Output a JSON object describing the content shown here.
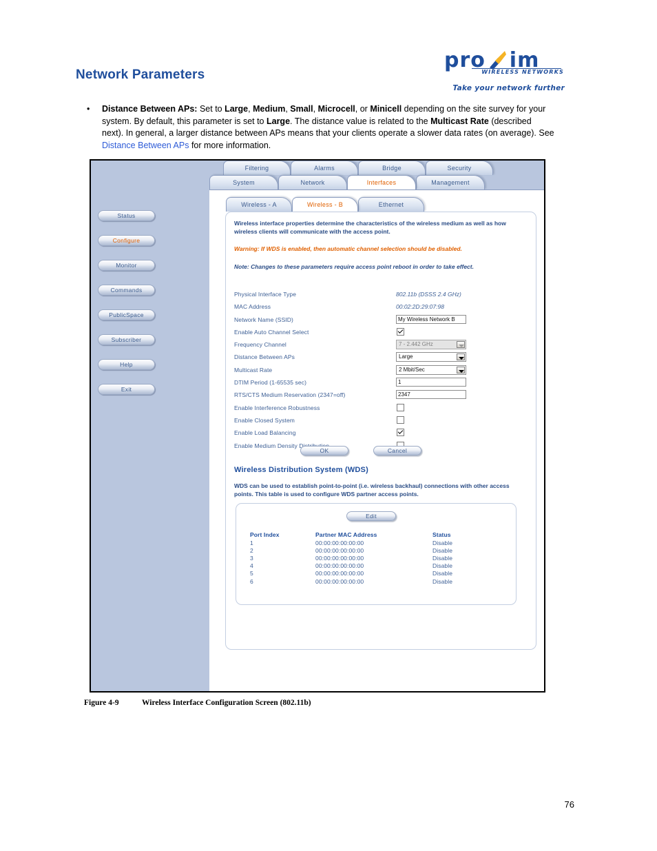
{
  "document": {
    "page_title": "Network Parameters",
    "page_number": "76",
    "figure_caption_number": "Figure 4-9",
    "figure_caption_text": "Wireless Interface Configuration Screen (802.11b)"
  },
  "logo": {
    "word_pro": "pro",
    "word_im": "im",
    "subtitle": "WIRELESS NETWORKS",
    "tagline": "Take your network further",
    "brand_blue": "#1F4E9C",
    "brand_gold": "#F5B324"
  },
  "bullet": {
    "marker": "•",
    "segments": [
      {
        "text": "Distance Between APs:",
        "style": "bold"
      },
      {
        "text": " Set to ",
        "style": "normal"
      },
      {
        "text": "Large",
        "style": "bold"
      },
      {
        "text": ", ",
        "style": "normal"
      },
      {
        "text": "Medium",
        "style": "bold"
      },
      {
        "text": ", ",
        "style": "normal"
      },
      {
        "text": "Small",
        "style": "bold"
      },
      {
        "text": ", ",
        "style": "normal"
      },
      {
        "text": "Microcell",
        "style": "bold"
      },
      {
        "text": ", or ",
        "style": "normal"
      },
      {
        "text": "Minicell",
        "style": "bold"
      },
      {
        "text": " depending on the site survey for your system. By default, this parameter is set to ",
        "style": "normal"
      },
      {
        "text": "Large",
        "style": "bold"
      },
      {
        "text": ". The distance value is related to the ",
        "style": "normal"
      },
      {
        "text": "Multicast Rate",
        "style": "bold"
      },
      {
        "text": " (described next). In general, a larger distance between APs means that your clients operate a slower data rates (on average). See ",
        "style": "normal"
      },
      {
        "text": "Distance Between APs",
        "style": "link"
      },
      {
        "text": " for more information.",
        "style": "normal"
      }
    ]
  },
  "app": {
    "sidebar": {
      "items": [
        {
          "label": "Status",
          "active": false
        },
        {
          "label": "Configure",
          "active": true
        },
        {
          "label": "Monitor",
          "active": false
        },
        {
          "label": "Commands",
          "active": false
        },
        {
          "label": "PublicSpace",
          "active": false
        },
        {
          "label": "Subscriber",
          "active": false
        },
        {
          "label": "Help",
          "active": false
        },
        {
          "label": "Exit",
          "active": false
        }
      ]
    },
    "tabs_upper": [
      {
        "label": "Filtering",
        "active": false
      },
      {
        "label": "Alarms",
        "active": false
      },
      {
        "label": "Bridge",
        "active": false
      },
      {
        "label": "Security",
        "active": false
      }
    ],
    "tabs_lower": [
      {
        "label": "System",
        "active": false
      },
      {
        "label": "Network",
        "active": false
      },
      {
        "label": "Interfaces",
        "active": true
      },
      {
        "label": "Management",
        "active": false
      }
    ],
    "tabs_sub": [
      {
        "label": "Wireless - A",
        "active": false
      },
      {
        "label": "Wireless - B",
        "active": true
      },
      {
        "label": "Ethernet",
        "active": false
      }
    ],
    "intro": "Wireless interface properties determine the characteristics of the wireless medium as well as how wireless clients will communicate with the access point.",
    "warning": "Warning: If WDS is enabled, then automatic channel selection should be disabled.",
    "note": "Note: Changes to these parameters require access point reboot in order to take effect.",
    "form_rows": [
      {
        "label": "Physical Interface Type",
        "type": "static",
        "value": "802.11b (DSSS 2.4 GHz)"
      },
      {
        "label": "MAC Address",
        "type": "static",
        "value": "00:02:2D:29:07:98"
      },
      {
        "label": "Network Name (SSID)",
        "type": "text",
        "value": "My Wireless Network B"
      },
      {
        "label": "Enable Auto Channel Select",
        "type": "checkbox",
        "checked": true
      },
      {
        "label": "Frequency Channel",
        "type": "select",
        "value": "7 - 2.442 GHz",
        "disabled": true
      },
      {
        "label": "Distance Between APs",
        "type": "select",
        "value": "Large",
        "disabled": false
      },
      {
        "label": "Multicast Rate",
        "type": "select",
        "value": "2 Mbit/Sec",
        "disabled": false
      },
      {
        "label": "DTIM Period (1-65535 sec)",
        "type": "text",
        "value": "1"
      },
      {
        "label": "RTS/CTS Medium Reservation (2347=off)",
        "type": "text",
        "value": "2347"
      },
      {
        "label": "Enable Interference Robustness",
        "type": "checkbox",
        "checked": false
      },
      {
        "label": "Enable Closed System",
        "type": "checkbox",
        "checked": false
      },
      {
        "label": "Enable Load Balancing",
        "type": "checkbox",
        "checked": true
      },
      {
        "label": "Enable Medium Density Distribution",
        "type": "checkbox",
        "checked": false
      }
    ],
    "actions": {
      "ok_label": "OK",
      "cancel_label": "Cancel"
    },
    "wds": {
      "title": "Wireless Distribution System (WDS)",
      "description": "WDS can be used to establish point-to-point (i.e. wireless backhaul) connections with other access points. This table is used to configure WDS partner access points.",
      "edit_label": "Edit",
      "columns": [
        "Port Index",
        "Partner MAC Address",
        "Status"
      ],
      "rows": [
        [
          "1",
          "00:00:00:00:00:00",
          "Disable"
        ],
        [
          "2",
          "00:00:00:00:00:00",
          "Disable"
        ],
        [
          "3",
          "00:00:00:00:00:00",
          "Disable"
        ],
        [
          "4",
          "00:00:00:00:00:00",
          "Disable"
        ],
        [
          "5",
          "00:00:00:00:00:00",
          "Disable"
        ],
        [
          "6",
          "00:00:00:00:00:00",
          "Disable"
        ]
      ]
    }
  }
}
